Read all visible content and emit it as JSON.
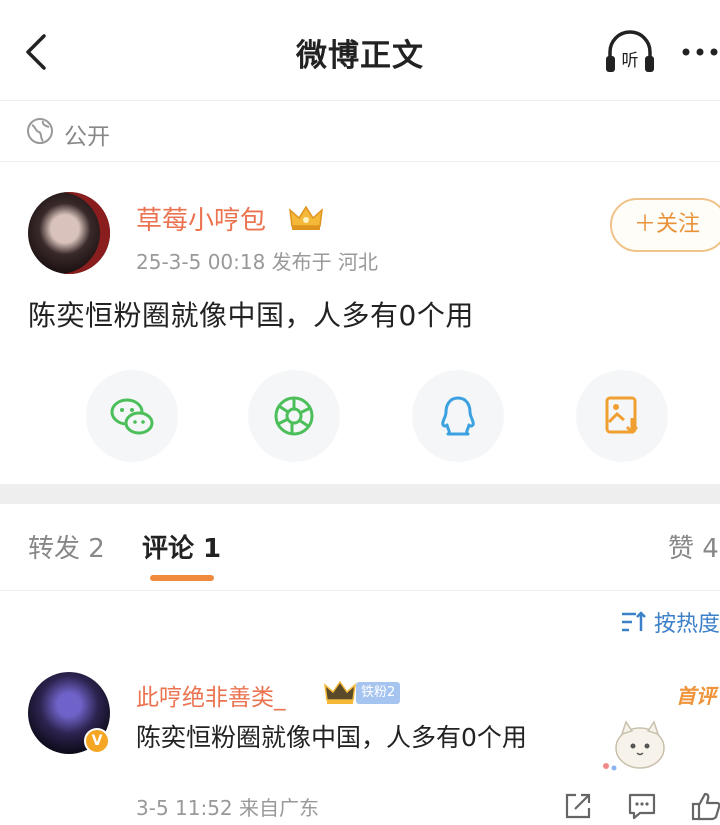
{
  "header": {
    "title": "微博正文",
    "listen_label": "听"
  },
  "visibility": {
    "label": "公开"
  },
  "post": {
    "author_name": "草莓小哼包",
    "time_location": "25-3-5 00:18  发布于 河北",
    "follow_label": "＋关注",
    "text": "陈奕恒粉圈就像中国，人多有0个用"
  },
  "share": {
    "items": [
      "wechat-icon",
      "moments-icon",
      "qq-icon",
      "save-image-icon"
    ],
    "colors": {
      "wechat": "#4cbf5a",
      "moments": "#4cbf5a",
      "qq": "#3ba1e0",
      "save": "#f0a030"
    }
  },
  "tabs": {
    "repost": "转发 2",
    "comments": "评论 1",
    "likes": "赞 4"
  },
  "sort": {
    "label": "按热度"
  },
  "comment": {
    "author_name": "此哼绝非善类_",
    "fan_badge": "铁粉2",
    "first_badge": "首评",
    "verified_mark": "V",
    "text": "陈奕恒粉圈就像中国，人多有0个用",
    "time_location": "3-5 11:52  来自广东"
  },
  "colors": {
    "accent_orange": "#eb7350",
    "link_blue": "#3b80c9",
    "tab_underline": "#f08a3c"
  }
}
